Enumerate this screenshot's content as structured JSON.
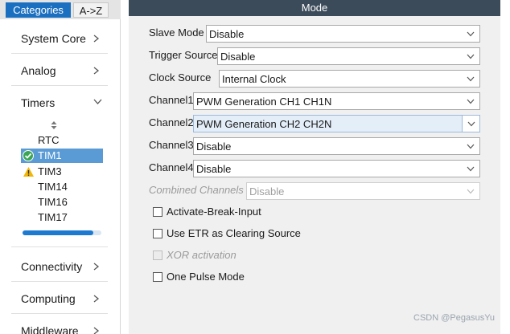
{
  "tabs": {
    "categories": "Categories",
    "az": "A->Z"
  },
  "categories": [
    {
      "label": "System Core",
      "chevron": "chevron-right"
    },
    {
      "label": "Analog",
      "chevron": "chevron-right"
    },
    {
      "label": "Timers",
      "chevron": "chevron-down"
    },
    {
      "label": "Connectivity",
      "chevron": "chevron-right"
    },
    {
      "label": "Computing",
      "chevron": "chevron-right"
    },
    {
      "label": "Middleware",
      "chevron": "chevron-right"
    }
  ],
  "timers": [
    {
      "label": "RTC",
      "status": "none"
    },
    {
      "label": "TIM1",
      "status": "ok",
      "selected": true
    },
    {
      "label": "TIM3",
      "status": "warning"
    },
    {
      "label": "TIM14",
      "status": "none"
    },
    {
      "label": "TIM16",
      "status": "none"
    },
    {
      "label": "TIM17",
      "status": "none"
    }
  ],
  "mode": {
    "title": "Mode",
    "fields": [
      {
        "label": "Slave Mode",
        "value": "Disable"
      },
      {
        "label": "Trigger Source",
        "value": "Disable"
      },
      {
        "label": "Clock Source",
        "value": "Internal Clock"
      },
      {
        "label": "Channel1",
        "value": "PWM Generation CH1 CH1N"
      },
      {
        "label": "Channel2",
        "value": "PWM Generation CH2 CH2N",
        "highlighted": true
      },
      {
        "label": "Channel3",
        "value": "Disable"
      },
      {
        "label": "Channel4",
        "value": "Disable"
      },
      {
        "label": "Combined Channels",
        "value": "Disable",
        "disabled": true
      }
    ],
    "checkboxes": [
      {
        "label": "Activate-Break-Input",
        "checked": false
      },
      {
        "label": "Use ETR as Clearing Source",
        "checked": false
      },
      {
        "label": "XOR activation",
        "checked": false,
        "disabled": true
      },
      {
        "label": "One Pulse Mode",
        "checked": false
      }
    ]
  },
  "sidebar_scroll_fraction": 0.9,
  "watermark": "CSDN @PegasusYu",
  "colors": {
    "accent": "#1b6fc0",
    "header": "#3c4b5a",
    "selection": "#5b9bd5",
    "ok": "#3aa655",
    "warning": "#f2b705"
  }
}
